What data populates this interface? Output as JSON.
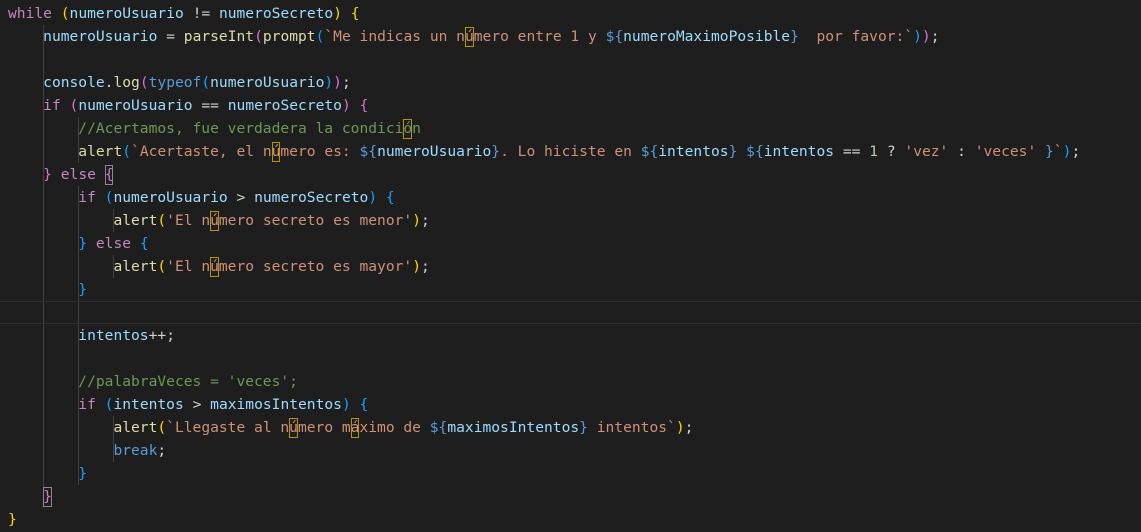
{
  "editor": {
    "language": "javascript",
    "lines": [
      "while (numeroUsuario != numeroSecreto) {",
      "    numeroUsuario = parseInt(prompt(`Me indicas un número entre 1 y ${numeroMaximoPosible}  por favor:`));",
      "",
      "    console.log(typeof(numeroUsuario));",
      "    if (numeroUsuario == numeroSecreto) {",
      "        //Acertamos, fue verdadera la condición",
      "        alert(`Acertaste, el número es: ${numeroUsuario}. Lo hiciste en ${intentos} ${intentos == 1 ? 'vez' : 'veces' }`);",
      "    } else {",
      "        if (numeroUsuario > numeroSecreto) {",
      "            alert('El número secreto es menor');",
      "        } else {",
      "            alert('El número secreto es mayor');",
      "        }",
      "",
      "        intentos++;",
      "",
      "        //palabraVeces = 'veces';",
      "        if (intentos > maximosIntentos) {",
      "            alert(`Llegaste al número máximo de ${maximosIntentos} intentos`);",
      "            break;",
      "        }",
      "    }",
      "}"
    ]
  },
  "colors": {
    "background": "#1e1e1e",
    "keyword": "#569cd6",
    "control": "#c586c0",
    "variable": "#9cdcfe",
    "function": "#dcdcaa",
    "string": "#ce9178",
    "number": "#b5cea8",
    "comment": "#6a9955",
    "bracket1": "#ffd700",
    "bracket2": "#da70d6",
    "bracket3": "#179fff"
  }
}
